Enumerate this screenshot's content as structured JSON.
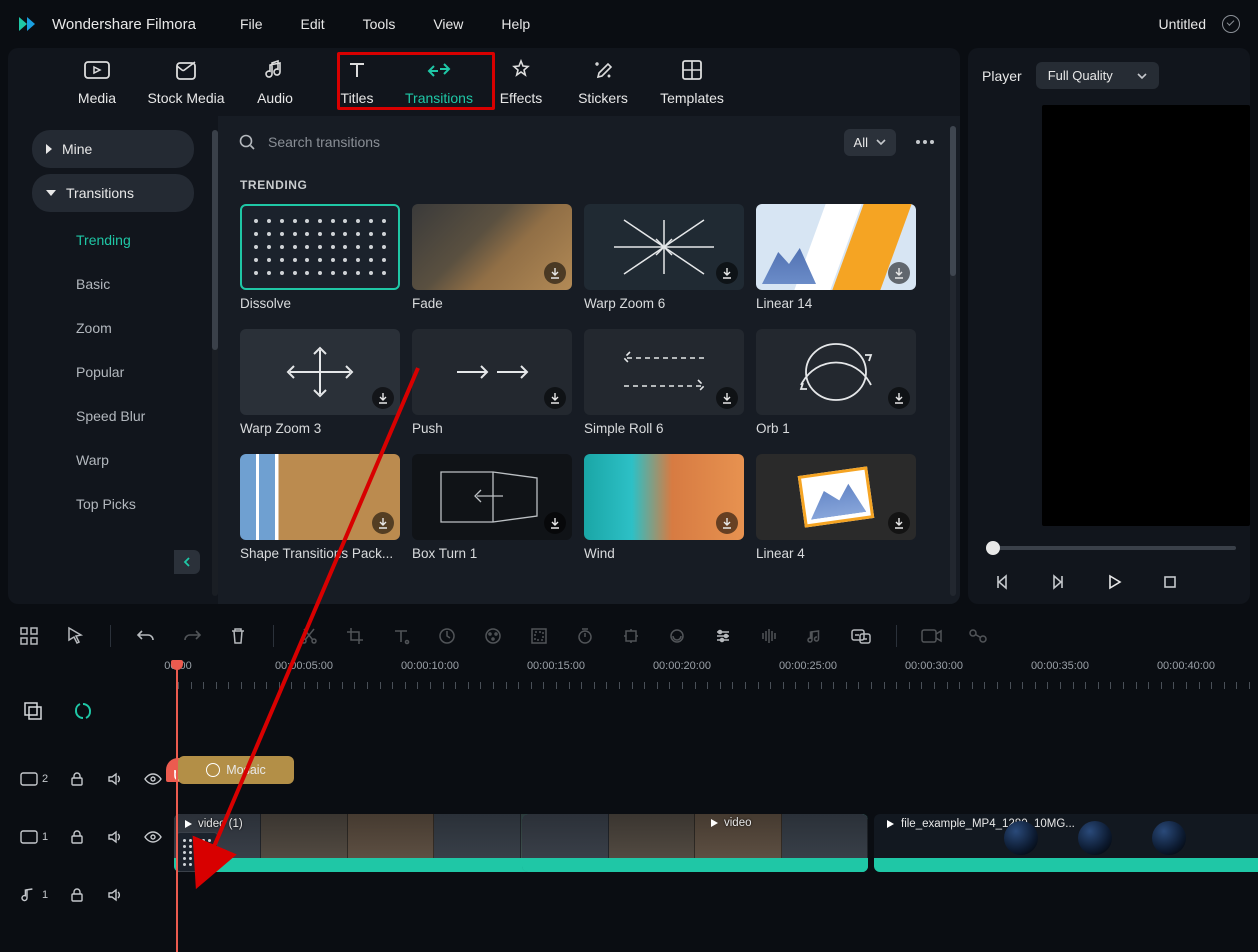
{
  "titlebar": {
    "app_name": "Wondershare Filmora",
    "project_name": "Untitled"
  },
  "menu": {
    "file": "File",
    "edit": "Edit",
    "tools": "Tools",
    "view": "View",
    "help": "Help"
  },
  "media_tabs": {
    "media": "Media",
    "stock": "Stock Media",
    "audio": "Audio",
    "titles": "Titles",
    "transitions": "Transitions",
    "effects": "Effects",
    "stickers": "Stickers",
    "templates": "Templates"
  },
  "sidebar": {
    "mine": "Mine",
    "transitions": "Transitions",
    "items": [
      "Trending",
      "Basic",
      "Zoom",
      "Popular",
      "Speed Blur",
      "Warp",
      "Top Picks"
    ]
  },
  "search": {
    "placeholder": "Search transitions",
    "filter": "All"
  },
  "section_title": "TRENDING",
  "thumbs": [
    "Dissolve",
    "Fade",
    "Warp Zoom 6",
    "Linear 14",
    "Warp Zoom 3",
    "Push",
    "Simple Roll 6",
    "Orb 1",
    "Shape Transitions Pack...",
    "Box Turn 1",
    "Wind",
    "Linear 4"
  ],
  "player": {
    "label": "Player",
    "quality": "Full Quality"
  },
  "timeline": {
    "timecodes": [
      "00:00",
      "00:00:05:00",
      "00:00:10:00",
      "00:00:15:00",
      "00:00:20:00",
      "00:00:25:00",
      "00:00:30:00",
      "00:00:35:00",
      "00:00:40:00"
    ],
    "effect_clip": "Mosaic",
    "clip1_label": "video (1)",
    "clip2_label": "video",
    "clip3_label": "file_example_MP4_1280_10MG...",
    "track_labels": {
      "v2": "2",
      "v1": "1",
      "a1": "1"
    }
  }
}
